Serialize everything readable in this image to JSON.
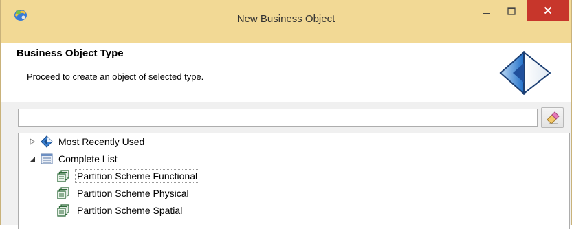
{
  "window": {
    "title": "New Business Object",
    "controls": {
      "minimize": "–",
      "maximize": "□",
      "close": "✕"
    },
    "colors": {
      "titlebar": "#f2d995",
      "close": "#c7362b"
    }
  },
  "header": {
    "title": "Business Object Type",
    "description": "Proceed to create an object of selected type."
  },
  "filter": {
    "value": "",
    "placeholder": ""
  },
  "tree": {
    "mru": {
      "label": "Most Recently Used",
      "expanded": false
    },
    "complete": {
      "label": "Complete List",
      "expanded": true,
      "items": [
        {
          "label": "Partition Scheme Functional",
          "selected": true
        },
        {
          "label": "Partition Scheme Physical",
          "selected": false
        },
        {
          "label": "Partition Scheme Spatial",
          "selected": false
        }
      ]
    }
  },
  "icons": {
    "app": "app-logo-icon",
    "header": "wizard-banner-icon",
    "clear": "eraser-icon",
    "mru": "blue-diamond-icon",
    "complete": "list-icon",
    "item": "partition-scheme-icon"
  }
}
